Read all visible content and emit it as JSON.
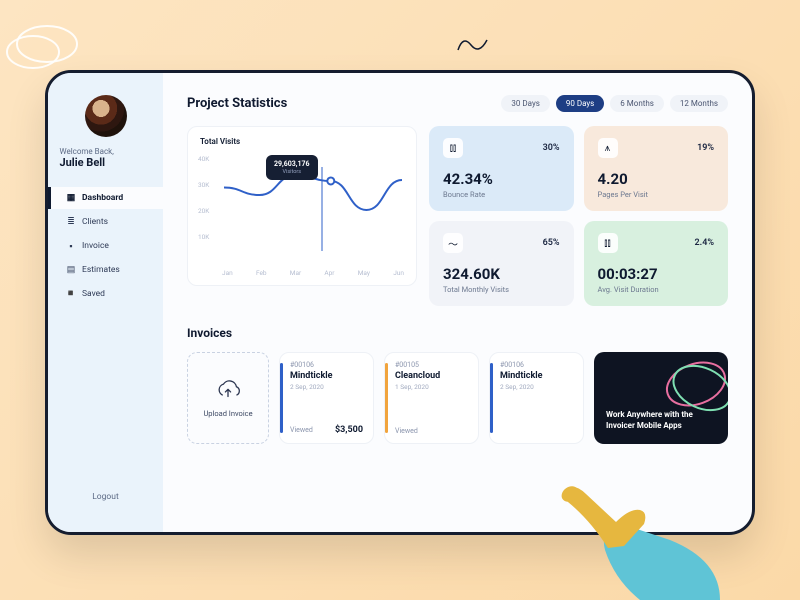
{
  "sidebar": {
    "welcome": "Welcome Back,",
    "user_name": "Julie Bell",
    "nav": [
      {
        "icon": "▦",
        "label": "Dashboard",
        "active": true
      },
      {
        "icon": "≣",
        "label": "Clients",
        "active": false
      },
      {
        "icon": "▪",
        "label": "Invoice",
        "active": false
      },
      {
        "icon": "▤",
        "label": "Estimates",
        "active": false
      },
      {
        "icon": "◾",
        "label": "Saved",
        "active": false
      }
    ],
    "logout": "Logout"
  },
  "header": {
    "title": "Project Statistics",
    "pills": [
      {
        "label": "30 Days",
        "active": false
      },
      {
        "label": "90 Days",
        "active": true
      },
      {
        "label": "6 Months",
        "active": false
      },
      {
        "label": "12 Months",
        "active": false
      }
    ]
  },
  "chart_data": {
    "type": "line",
    "title": "Total Visits",
    "ylabel": "",
    "xlabel": "",
    "ylim": [
      0,
      40000
    ],
    "y_ticks": [
      "40K",
      "30K",
      "20K",
      "10K"
    ],
    "categories": [
      "Jan",
      "Feb",
      "Mar",
      "Apr",
      "May",
      "Jun"
    ],
    "values": [
      27000,
      24000,
      32000,
      29603,
      18000,
      30000
    ],
    "tooltip": {
      "value": "29,603,176",
      "label": "Visitors",
      "at_index": 3
    }
  },
  "stats": [
    {
      "percent": "30%",
      "value": "42.34%",
      "label": "Bounce Rate",
      "color": "blue",
      "icon": "bars"
    },
    {
      "percent": "19%",
      "value": "4.20",
      "label": "Pages Per Visit",
      "color": "peach",
      "icon": "pulse"
    },
    {
      "percent": "65%",
      "value": "324.60K",
      "label": "Total Monthly Visits",
      "color": "gray",
      "icon": "trend"
    },
    {
      "percent": "2.4%",
      "value": "00:03:27",
      "label": "Avg. Visit Duration",
      "color": "green",
      "icon": "bars"
    }
  ],
  "invoices": {
    "title": "Invoices",
    "upload_label": "Upload Invoice",
    "cards": [
      {
        "id": "#00106",
        "name": "Mindtickle",
        "date": "2 Sep, 2020",
        "status": "Viewed",
        "amount": "$3,500",
        "stripe": "b1"
      },
      {
        "id": "#00105",
        "name": "Cleancloud",
        "date": "1 Sep, 2020",
        "status": "Viewed",
        "amount": "",
        "stripe": "b2"
      },
      {
        "id": "#00106",
        "name": "Mindtickle",
        "date": "2 Sep, 2020",
        "status": "",
        "amount": "",
        "stripe": "b3"
      }
    ]
  },
  "promo": {
    "text": "Work Anywhere with the Invoicer Mobile Apps"
  }
}
